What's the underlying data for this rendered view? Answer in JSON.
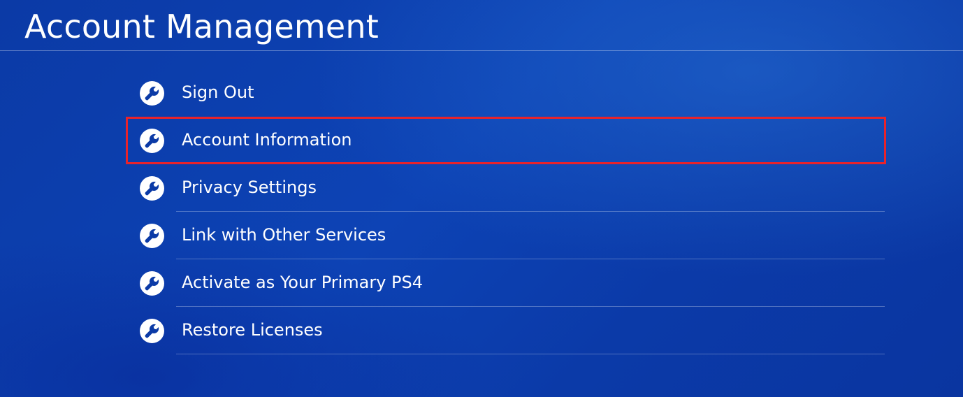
{
  "header": {
    "title": "Account Management"
  },
  "menu": {
    "items": [
      {
        "label": "Sign Out",
        "icon": "wrench-icon",
        "selected": false
      },
      {
        "label": "Account Information",
        "icon": "wrench-icon",
        "selected": true
      },
      {
        "label": "Privacy Settings",
        "icon": "wrench-icon",
        "selected": false
      },
      {
        "label": "Link with Other Services",
        "icon": "wrench-icon",
        "selected": false
      },
      {
        "label": "Activate as Your Primary PS4",
        "icon": "wrench-icon",
        "selected": false
      },
      {
        "label": "Restore Licenses",
        "icon": "wrench-icon",
        "selected": false
      }
    ]
  },
  "colors": {
    "background": "#0b3aa6",
    "text": "#ffffff",
    "selection_border": "#e8232b"
  }
}
